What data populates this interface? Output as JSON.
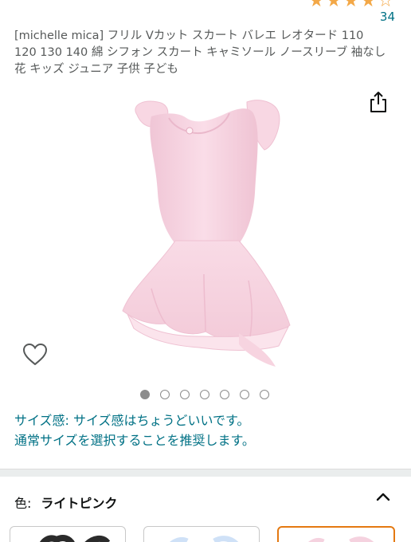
{
  "rating": {
    "stars_filled": 4,
    "stars_total": 5,
    "count": "34"
  },
  "product": {
    "title": "[michelle mica] フリル Vカット スカート バレエ レオタード 110 120 130 140 綿 シフォン スカート キャミソール ノースリーブ 袖なし 花 キッズ ジュニア 子供 子ども"
  },
  "gallery": {
    "image_count": 7,
    "active_index": 0
  },
  "size_note": {
    "line1": "サイズ感: サイズ感はちょうどいいです。",
    "line2": "通常サイズを選択することを推奨します。"
  },
  "variant": {
    "label": "色:",
    "value": "ライトピンク"
  },
  "colors": {
    "link": "#007185",
    "star": "#f3a847",
    "selected_border": "#e47911",
    "garment": "#f6d3e0"
  }
}
